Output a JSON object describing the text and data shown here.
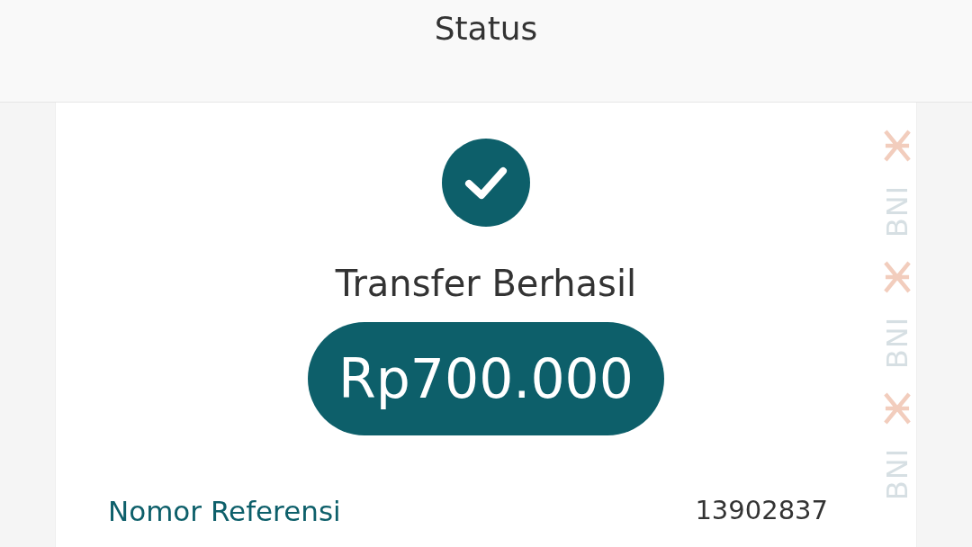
{
  "header": {
    "title": "Status"
  },
  "status": {
    "kind": "success",
    "title": "Transfer Berhasil"
  },
  "amount": "Rp700.000",
  "details": [
    {
      "label": "Nomor Referensi",
      "value": "13902837"
    }
  ],
  "brand_mark": [
    "BNI",
    "BNI",
    "BNI"
  ]
}
